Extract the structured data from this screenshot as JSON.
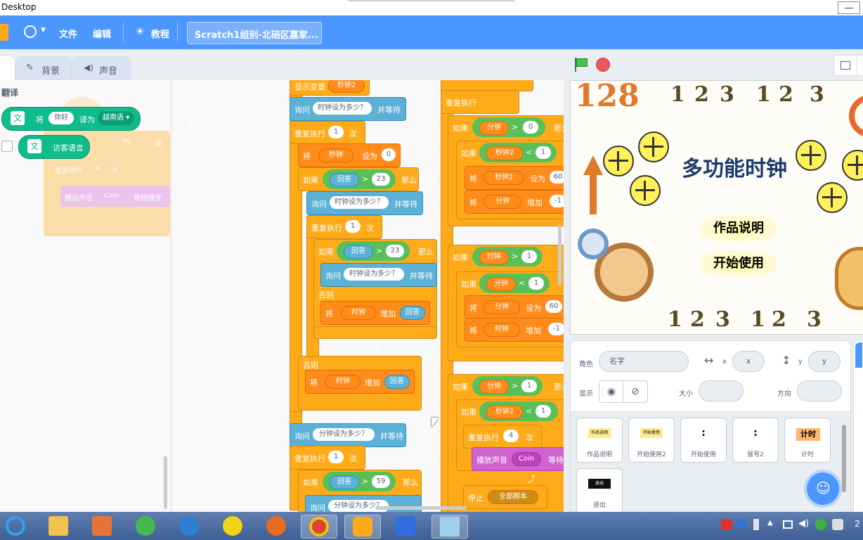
{
  "window": {
    "title": "Desktop"
  },
  "menubar": {
    "file": "文件",
    "edit": "编辑",
    "tutorials": "教程",
    "project_title": "Scratch1组别-北碚区嘉家..."
  },
  "tabs": {
    "backdrops": "背景",
    "sounds": "声音"
  },
  "palette": {
    "category": "翻译",
    "translate_block": {
      "pre": "将",
      "text": "你好",
      "mid": "译为",
      "lang": "越南语"
    },
    "language_block": "访客语言",
    "ghost_blocks": {
      "repeat_label": "重复执行",
      "repeat_count": "4",
      "repeat_unit": "次",
      "play_label": "播放声音",
      "sound": "Coin",
      "until": "等待播完",
      "num": "30",
      "or": "或"
    }
  },
  "dragged_block": {
    "var": "分钟",
    "op": "=",
    "val": "0",
    "then": "那么"
  },
  "script_col1": [
    {
      "t": "显示变量",
      "a": "秒钟2"
    },
    {
      "t": "询问",
      "a": "时钟设为多少？",
      "b": "并等待"
    },
    {
      "t": "重复执行",
      "a": "1",
      "b": "次"
    },
    {
      "t": "将",
      "a": "秒钟",
      "b": "设为",
      "c": "0"
    },
    {
      "t": "如果",
      "a": "回答",
      "op": ">",
      "c": "23",
      "b": "那么"
    },
    {
      "t": "询问",
      "a": "时钟设为多少？",
      "b": "并等待"
    },
    {
      "t": "重复执行",
      "a": "1",
      "b": "次"
    },
    {
      "t": "如果",
      "a": "回答",
      "op": ">",
      "c": "23",
      "b": "那么"
    },
    {
      "t": "询问",
      "a": "时钟设为多少？",
      "b": "并等待"
    },
    {
      "t": "否则"
    },
    {
      "t": "将",
      "a": "时钟",
      "b": "增加",
      "c": "回答"
    },
    {
      "t": "否则"
    },
    {
      "t": "将",
      "a": "时钟",
      "b": "增加",
      "c": "回答"
    },
    {
      "t": "询问",
      "a": "分钟设为多少？",
      "b": "并等待"
    },
    {
      "t": "重复执行",
      "a": "1",
      "b": "次"
    },
    {
      "t": "如果",
      "a": "回答",
      "op": ">",
      "c": "59",
      "b": "那么"
    },
    {
      "t": "询问",
      "a": "分钟设为多少？",
      "b": "并等待"
    }
  ],
  "script_col2": [
    {
      "t": "重复执行"
    },
    {
      "t": "如果",
      "a": "分钟",
      "op": ">",
      "c": "0",
      "b": "那么"
    },
    {
      "t": "如果",
      "a": "秒钟2",
      "op": "<",
      "c": "1"
    },
    {
      "t": "将",
      "a": "秒钟2",
      "b": "设为",
      "c": "60"
    },
    {
      "t": "将",
      "a": "分钟",
      "b": "增加",
      "c": "-1"
    },
    {
      "t": "如果",
      "a": "时钟",
      "op": ">",
      "c": "1"
    },
    {
      "t": "如果",
      "a": "分钟",
      "op": "<",
      "c": "1"
    },
    {
      "t": "将",
      "a": "分钟",
      "b": "设为",
      "c": "60"
    },
    {
      "t": "将",
      "a": "时钟",
      "b": "增加",
      "c": "-1"
    },
    {
      "t": "如果",
      "a": "分钟",
      "op": ">",
      "c": "1",
      "b": "那么"
    },
    {
      "t": "如果",
      "a": "秒钟2",
      "op": "<",
      "c": "1"
    },
    {
      "t": "重复执行",
      "a": "4",
      "b": "次"
    },
    {
      "t": "播放声音",
      "a": "Coin",
      "b": "等待"
    },
    {
      "t": "停止",
      "a": "全部脚本"
    }
  ],
  "stage": {
    "title": "多功能时钟",
    "btn_about": "作品说明",
    "btn_start": "开始使用",
    "top_numbers": [
      "1",
      "2",
      "3",
      "1",
      "2",
      "3"
    ],
    "bottom_numbers": [
      "1",
      "2",
      "3",
      "1",
      "2",
      "3"
    ],
    "corner_numbers": "128"
  },
  "sprite_info": {
    "sprite_label": "角色",
    "name_placeholder": "名字",
    "x_label": "x",
    "x_placeholder": "x",
    "y_label": "y",
    "y_placeholder": "y",
    "show_label": "显示",
    "size_label": "大小",
    "direction_label": "方向"
  },
  "sprites": [
    {
      "name": "作品说明",
      "thumb": "作品说明"
    },
    {
      "name": "开始使用2",
      "thumb": "开始使用"
    },
    {
      "name": "开始使用",
      "thumb": ":"
    },
    {
      "name": "冒号2",
      "thumb": ":"
    },
    {
      "name": "计时",
      "thumb": "计时"
    },
    {
      "name": "退出",
      "thumb": "退出"
    }
  ],
  "taskbar": {
    "clock": "2"
  }
}
